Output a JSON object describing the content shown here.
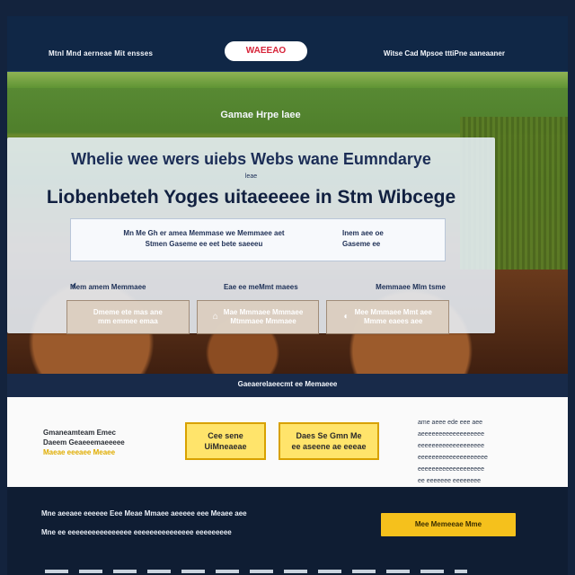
{
  "brand": "WAEEAO",
  "nav": {
    "left": "Mtnl Mnd aerneae Mit ensses",
    "right": "Witse Cad Mpsoe tttiPne aaneaaner"
  },
  "hero": {
    "label": "Gamae Hrpe laee",
    "headline": "Whelie wee wers uiebs Webs wane Eumndarye",
    "small": "leae",
    "subheadline": "Liobenbeteh Yoges uitaeeeee in Stm Wibcege",
    "info_left": "Mn Me Gh er amea Memmase we Memmaee aet\nStmen Gaseme ee eet bete saeeeu",
    "info_right": "Inem aee oe\nGaseme ee",
    "tabs": [
      "Mem amem Memmaee",
      "Eae ee meMmt maees",
      "Memmaee Mlm tsme"
    ],
    "cards": [
      "Dmeme ete mas ane\nmm emmee emaa",
      "Mae Mmmaee Mmmaee\nMtmmaee Mmmaee",
      "Mee Mmmaee Mmt aee\nMmme eaees aee"
    ]
  },
  "mid": "Gaeaerelaeecmt ee Memaeee",
  "content": {
    "left_lines": [
      "Gmaneamteam Emec",
      "Daeem Geaeeemaeeeee",
      "Maeae eeeaee Meaee"
    ],
    "cta1": "Cee sene\nUiMneaeae",
    "cta2": "Daes Se Gmn Me\nee aseene ae eeeae",
    "right_lines": [
      "ame aeee ede eee aee",
      "aeeeeeeeeeeeeeeeeee",
      "eeeeeeeeeeeeeeeeeee",
      "eeeeeeeeeeeeeeeeeeee",
      "eeeeeeeeeeeeeeeeeee",
      "ee eeeeeee eeeeeeee"
    ]
  },
  "footer": {
    "line1": "Mne aeeaee eeeeee Eee  Meae Mmaee aeeeee eee Meaee aee",
    "line2": "Mne ee eeeeeeeeeeeeeeee eeeeeeeeeeeeeee eeeeeeeee",
    "button": "Mee Memeeae Mme"
  }
}
